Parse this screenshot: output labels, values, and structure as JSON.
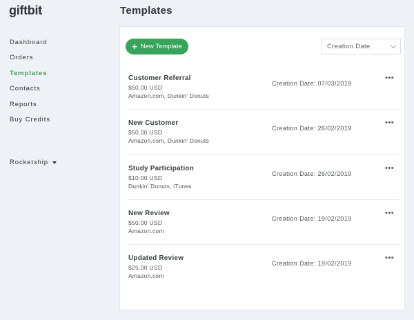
{
  "brand": {
    "logo_text": "giftbit"
  },
  "sidebar": {
    "items": [
      {
        "label": "Dashboard"
      },
      {
        "label": "Orders"
      },
      {
        "label": "Templates"
      },
      {
        "label": "Contacts"
      },
      {
        "label": "Reports"
      },
      {
        "label": "Buy Credits"
      }
    ],
    "active_item": "Templates",
    "org_switcher": {
      "label": "Rocketship"
    }
  },
  "page": {
    "title": "Templates"
  },
  "toolbar": {
    "new_template_label": "New Template",
    "sort": {
      "selected": "Creation Date"
    }
  },
  "templates": [
    {
      "name": "Customer Referral",
      "amount": "$50.00 USD",
      "brands": "Amazon.com, Dunkin' Donuts",
      "date": "Creation Date: 07/03/2019"
    },
    {
      "name": "New Customer",
      "amount": "$50.00 USD",
      "brands": "Amazon.com, Dunkin' Donuts",
      "date": "Creation Date: 26/02/2019"
    },
    {
      "name": "Study Participation",
      "amount": "$10.00 USD",
      "brands": "Dunkin' Donuts, iTunes",
      "date": "Creation Date: 26/02/2019"
    },
    {
      "name": "New Review",
      "amount": "$50.00 USD",
      "brands": "Amazon.com",
      "date": "Creation Date: 19/02/2019"
    },
    {
      "name": "Updated Review",
      "amount": "$25.00 USD",
      "brands": "Amazon.com",
      "date": "Creation Date: 19/02/2019"
    }
  ],
  "icons": {
    "more": "more-horizontal-icon",
    "plus": "plus-icon",
    "chevron": "chevron-down-icon",
    "caret": "caret-down-icon"
  },
  "colors": {
    "accent": "#3aa35b",
    "background": "#eef1f5",
    "panel": "#ffffff",
    "text": "#2e353b"
  }
}
